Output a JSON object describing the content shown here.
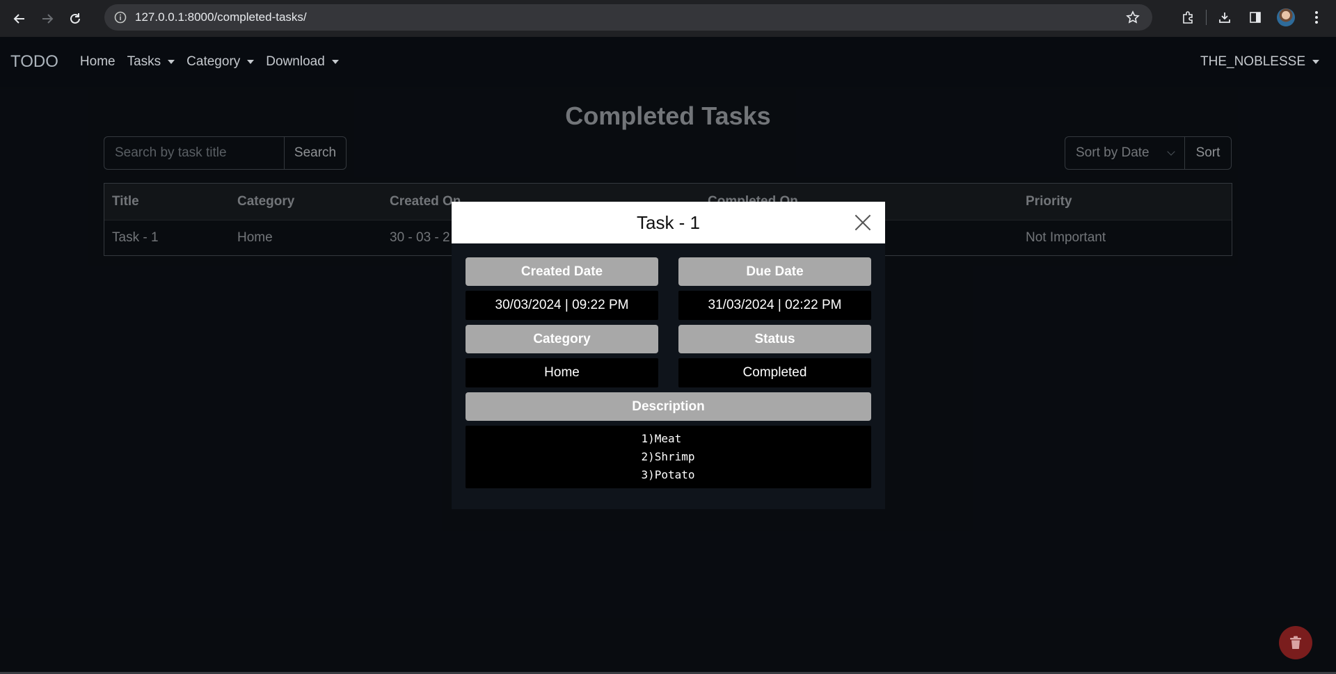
{
  "browser": {
    "url": "127.0.0.1:8000/completed-tasks/"
  },
  "navbar": {
    "brand": "TODO",
    "links": [
      {
        "label": "Home",
        "dropdown": false
      },
      {
        "label": "Tasks",
        "dropdown": true
      },
      {
        "label": "Category",
        "dropdown": true
      },
      {
        "label": "Download",
        "dropdown": true
      }
    ],
    "user": "THE_NOBLESSE"
  },
  "main": {
    "title": "Completed Tasks",
    "search": {
      "placeholder": "Search by task title",
      "button": "Search"
    },
    "sort": {
      "selected": "Sort by Date",
      "button": "Sort"
    },
    "table": {
      "headers": [
        "Title",
        "Category",
        "Created On",
        "Completed On",
        "Priority"
      ],
      "rows": [
        {
          "title": "Task - 1",
          "category": "Home",
          "created": "30 - 03 - 2",
          "completed": "",
          "priority": "Not Important"
        }
      ]
    }
  },
  "modal": {
    "title": "Task - 1",
    "created_label": "Created Date",
    "created_value": "30/03/2024 | 09:22 PM",
    "due_label": "Due Date",
    "due_value": "31/03/2024 | 02:22 PM",
    "category_label": "Category",
    "category_value": "Home",
    "status_label": "Status",
    "status_value": "Completed",
    "description_label": "Description",
    "description_lines": [
      "1)Meat",
      "2)Shrimp",
      "3)Potato"
    ]
  },
  "colors": {
    "background": "#0d1117",
    "navbar": "#080b10",
    "label_gray": "#a8a8a8",
    "fab_red": "#7a1d1d"
  },
  "icons": [
    "back-icon",
    "forward-icon",
    "reload-icon",
    "site-info-icon",
    "star-icon",
    "extensions-icon",
    "download-icon",
    "sidepanel-icon",
    "menu-icon",
    "trash-icon",
    "close-icon"
  ]
}
